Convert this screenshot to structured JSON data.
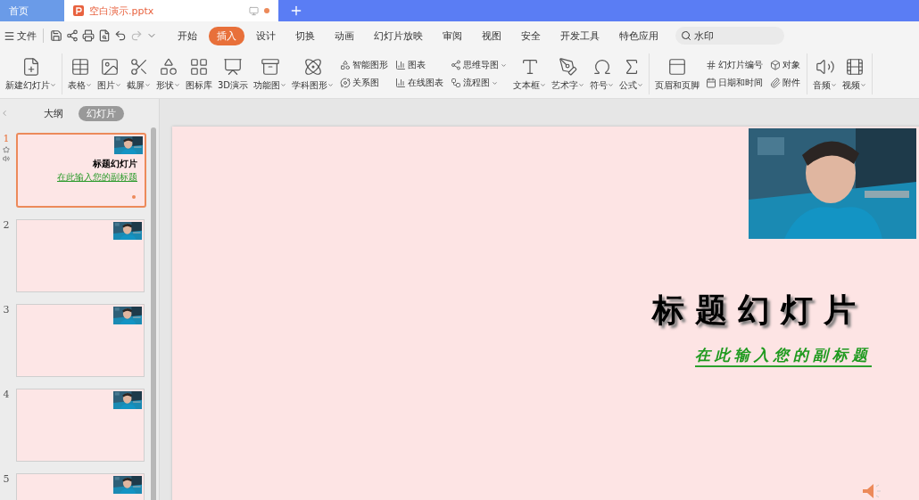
{
  "title_tabs": [
    {
      "label": "首页",
      "kind": "home",
      "selected": false,
      "modified": false
    },
    {
      "label": "空白演示.pptx",
      "kind": "doc",
      "selected": true,
      "modified": true
    }
  ],
  "menu": {
    "file": "文件",
    "tabs": [
      {
        "label": "开始",
        "selected": false
      },
      {
        "label": "插入",
        "selected": true
      },
      {
        "label": "设计",
        "selected": false
      },
      {
        "label": "切换",
        "selected": false
      },
      {
        "label": "动画",
        "selected": false
      },
      {
        "label": "幻灯片放映",
        "selected": false
      },
      {
        "label": "审阅",
        "selected": false
      },
      {
        "label": "视图",
        "selected": false
      },
      {
        "label": "安全",
        "selected": false
      },
      {
        "label": "开发工具",
        "selected": false
      },
      {
        "label": "特色应用",
        "selected": false
      }
    ],
    "search": {
      "placeholder": "水印"
    }
  },
  "ribbon": [
    {
      "items": [
        {
          "kind": "large",
          "label": "新建幻灯片",
          "menu": true
        }
      ]
    },
    {
      "items": [
        {
          "kind": "large",
          "label": "表格",
          "menu": true
        },
        {
          "kind": "large",
          "label": "图片",
          "menu": true
        },
        {
          "kind": "large",
          "label": "截屏",
          "menu": true
        },
        {
          "kind": "large",
          "label": "形状",
          "menu": true
        },
        {
          "kind": "large",
          "label": "图标库",
          "menu": false
        },
        {
          "kind": "large",
          "label": "3D演示",
          "menu": false
        },
        {
          "kind": "large",
          "label": "功能图",
          "menu": true
        },
        {
          "kind": "large",
          "label": "学科图形",
          "menu": true
        },
        {
          "kind": "stack",
          "rows": [
            {
              "label": "智能图形",
              "menu": false
            },
            {
              "label": "关系图",
              "menu": false
            }
          ]
        },
        {
          "kind": "stack",
          "rows": [
            {
              "label": "图表",
              "menu": false
            },
            {
              "label": "在线图表",
              "menu": false
            }
          ]
        },
        {
          "kind": "stack",
          "rows": [
            {
              "label": "思维导图",
              "menu": true
            },
            {
              "label": "流程图",
              "menu": true
            }
          ]
        },
        {
          "kind": "large",
          "label": "文本框",
          "menu": true
        },
        {
          "kind": "large",
          "label": "艺术字",
          "menu": true
        },
        {
          "kind": "large",
          "label": "符号",
          "menu": true
        },
        {
          "kind": "large",
          "label": "公式",
          "menu": true
        }
      ]
    },
    {
      "items": [
        {
          "kind": "large",
          "label": "页眉和页脚",
          "menu": false
        },
        {
          "kind": "stack",
          "rows": [
            {
              "label": "幻灯片编号",
              "menu": false
            },
            {
              "label": "日期和时间",
              "menu": false
            }
          ]
        },
        {
          "kind": "stack",
          "rows": [
            {
              "label": "对象",
              "menu": false
            },
            {
              "label": "附件",
              "menu": false
            }
          ]
        }
      ]
    },
    {
      "items": [
        {
          "kind": "large",
          "label": "音频",
          "menu": true
        },
        {
          "kind": "large",
          "label": "视频",
          "menu": true
        }
      ]
    }
  ],
  "panel": {
    "views": [
      {
        "label": "大纲",
        "selected": false
      },
      {
        "label": "幻灯片",
        "selected": true
      }
    ],
    "slides": [
      {
        "number": "1",
        "selected": true,
        "animated": true,
        "audio": true,
        "title": "标题幻灯片",
        "subtitle": "在此输入您的副标题"
      },
      {
        "number": "2",
        "selected": false,
        "animated": false,
        "audio": false
      },
      {
        "number": "3",
        "selected": false,
        "animated": false,
        "audio": false
      },
      {
        "number": "4",
        "selected": false,
        "animated": false,
        "audio": false
      },
      {
        "number": "5",
        "selected": false,
        "animated": false,
        "audio": false
      }
    ]
  },
  "slide": {
    "title": "标题幻灯片",
    "subtitle": "在此输入您的副标题",
    "audio": true
  }
}
